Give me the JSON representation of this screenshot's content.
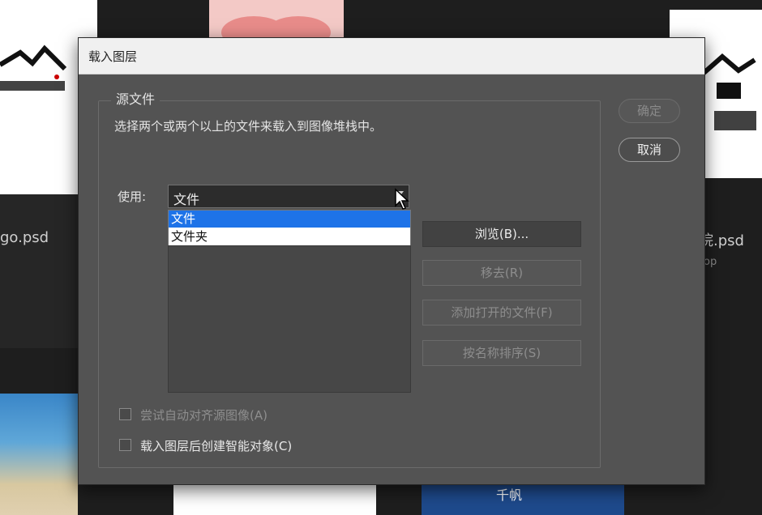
{
  "background": {
    "left_file_label": "go.psd",
    "right_file_label": "院.psd",
    "right_file_sub": "op",
    "bottom_thumb_text": "千帆"
  },
  "dialog": {
    "title": "载入图层",
    "group_label": "源文件",
    "description": "选择两个或两个以上的文件来载入到图像堆栈中。",
    "use_label": "使用:",
    "use_select": {
      "value": "文件",
      "options": [
        "文件",
        "文件夹"
      ],
      "highlighted": "文件"
    },
    "buttons": {
      "browse": "浏览(B)...",
      "remove": "移去(R)",
      "add_open": "添加打开的文件(F)",
      "sort_name": "按名称排序(S)"
    },
    "side_buttons": {
      "ok": "确定",
      "cancel": "取消"
    },
    "checkboxes": {
      "auto_align": "尝试自动对齐源图像(A)",
      "smart_object": "载入图层后创建智能对象(C)"
    }
  },
  "colors": {
    "dialog_bg": "#535353",
    "selection": "#1e73e8"
  }
}
